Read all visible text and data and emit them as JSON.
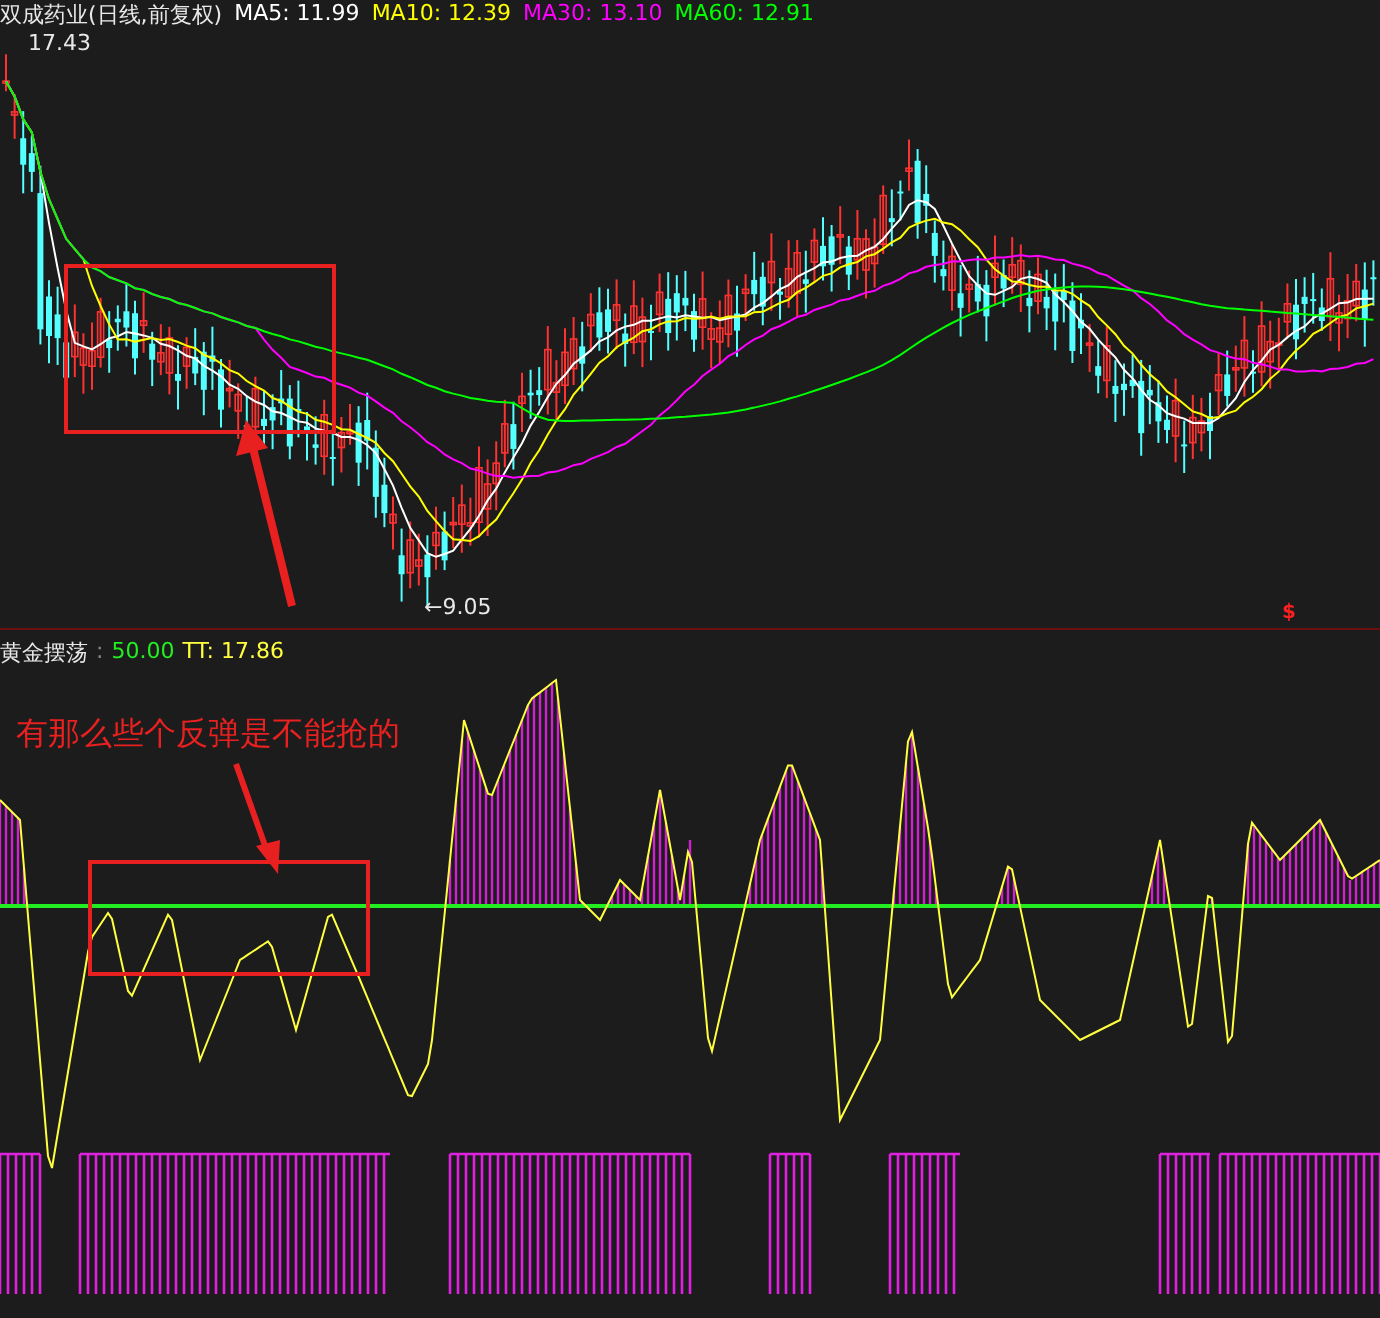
{
  "price_panel": {
    "title": "双成药业(日线,前复权)",
    "ma_labels": [
      {
        "text": "MA5: 11.99",
        "color": "#ffffff"
      },
      {
        "text": "MA10: 12.39",
        "color": "#ffff00"
      },
      {
        "text": "MA30: 13.10",
        "color": "#ff00ff"
      },
      {
        "text": "MA60: 12.91",
        "color": "#00ff00"
      }
    ],
    "high_label": "17.43",
    "low_label": "←9.05",
    "marker": "$"
  },
  "indicator_panel": {
    "name": "黄金摆荡",
    "separator": ":",
    "level_value": "50.00",
    "tt_label": "TT: 17.86",
    "annotation": "有那么些个反弹是不能抢的"
  }
}
